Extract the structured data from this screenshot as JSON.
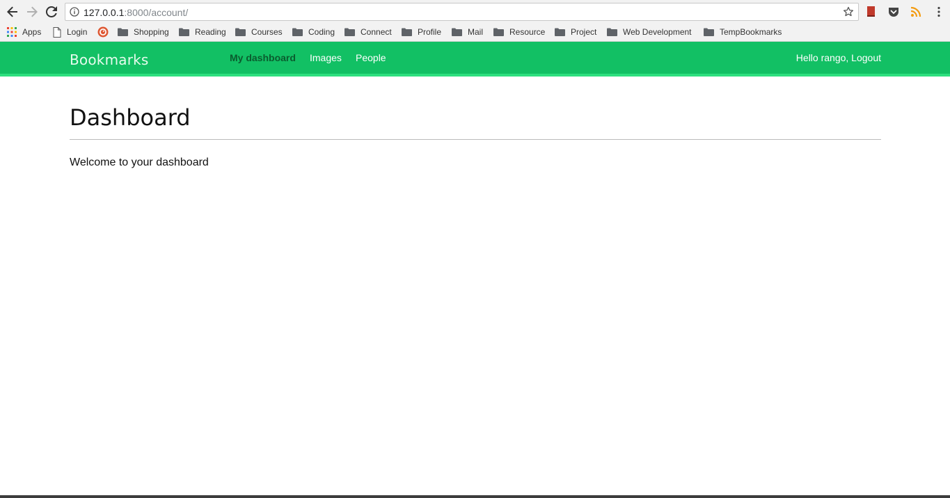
{
  "browser": {
    "url_host": "127.0.0.1",
    "url_path": ":8000/account/"
  },
  "bookmarks": [
    {
      "label": "Apps",
      "icon": "apps-grid-icon"
    },
    {
      "label": "Login",
      "icon": "page-icon"
    },
    {
      "label": "",
      "icon": "duckduckgo-icon"
    },
    {
      "label": "Shopping",
      "icon": "folder-icon"
    },
    {
      "label": "Reading",
      "icon": "folder-icon"
    },
    {
      "label": "Courses",
      "icon": "folder-icon"
    },
    {
      "label": "Coding",
      "icon": "folder-icon"
    },
    {
      "label": "Connect",
      "icon": "folder-icon"
    },
    {
      "label": "Profile",
      "icon": "folder-icon"
    },
    {
      "label": "Mail",
      "icon": "folder-icon"
    },
    {
      "label": "Resource",
      "icon": "folder-icon"
    },
    {
      "label": "Project",
      "icon": "folder-icon"
    },
    {
      "label": "Web Development",
      "icon": "folder-icon"
    },
    {
      "label": "TempBookmarks",
      "icon": "folder-icon"
    }
  ],
  "site": {
    "logo": "Bookmarks",
    "menu": [
      {
        "label": "My dashboard",
        "active": true
      },
      {
        "label": "Images",
        "active": false
      },
      {
        "label": "People",
        "active": false
      }
    ],
    "user_text": "Hello rango, Logout",
    "header_color": "#12c064"
  },
  "content": {
    "title": "Dashboard",
    "welcome": "Welcome to your dashboard"
  }
}
